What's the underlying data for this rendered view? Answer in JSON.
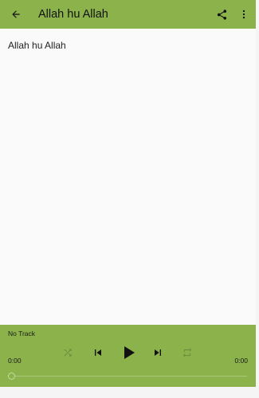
{
  "appbar": {
    "title": "Allah hu Allah",
    "back_icon": "arrow-back-icon",
    "share_icon": "share-icon",
    "menu_icon": "more-vert-icon",
    "color": "#8bb24b"
  },
  "content": {
    "lyrics_text": "Allah hu Allah"
  },
  "player": {
    "track_title": "No Track",
    "elapsed": "0:00",
    "duration": "0:00",
    "progress": 0,
    "controls": [
      "shuffle-icon",
      "skip-previous-icon",
      "play-icon",
      "skip-next-icon",
      "repeat-icon"
    ]
  }
}
